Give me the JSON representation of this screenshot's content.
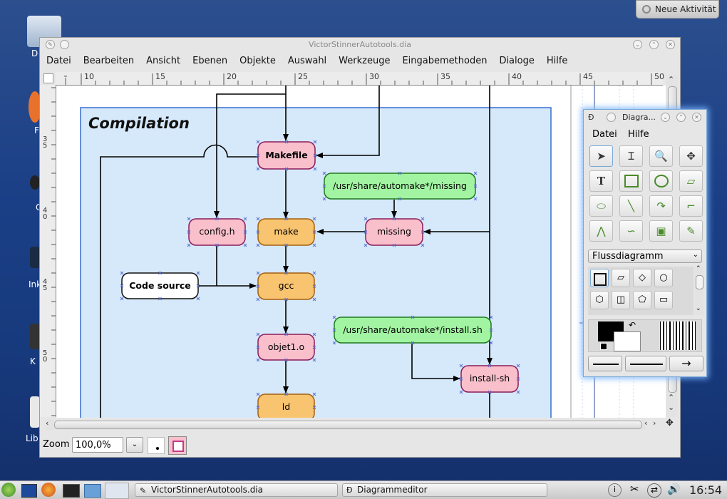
{
  "desktop": {
    "neue_aktivitaet": "Neue Aktivität",
    "icon_labels": [
      "D",
      "F",
      "C",
      "Ink",
      "K",
      "Lib"
    ]
  },
  "window": {
    "title": "VictorStinnerAutotools.dia",
    "menu": [
      "Datei",
      "Bearbeiten",
      "Ansicht",
      "Ebenen",
      "Objekte",
      "Auswahl",
      "Werkzeuge",
      "Eingabemethoden",
      "Dialoge",
      "Hilfe"
    ],
    "ruler_top": [
      "10",
      "15",
      "20",
      "25",
      "30",
      "35",
      "40",
      "45",
      "50"
    ],
    "ruler_left": [
      "3\n5",
      "4\n0",
      "4\n5",
      "5\n0"
    ],
    "zoom_label": "Zoom",
    "zoom_value": "100,0%"
  },
  "diagram": {
    "group_title": "Compilation",
    "nodes": {
      "makefile": "Makefile",
      "missing_path": "/usr/share/automake*/missing",
      "config_h": "config.h",
      "make": "make",
      "missing": "missing",
      "code_source": "Code source",
      "gcc": "gcc",
      "install_path": "/usr/share/automake*/install.sh",
      "objet1": "objet1.o",
      "install_sh": "install-sh",
      "ld": "ld"
    }
  },
  "toolbox": {
    "title": "Diagra...",
    "menu": [
      "Datei",
      "Hilfe"
    ],
    "sheet": "Flussdiagramm"
  },
  "taskbar": {
    "task1": "VictorStinnerAutotools.dia",
    "task2": "Diagrammeditor",
    "clock": "16:54"
  },
  "colors": {
    "group_fill": "#d6e9fb",
    "pink": "#f9c0cc",
    "orange": "#f9c46f",
    "green": "#a2f4a2"
  }
}
